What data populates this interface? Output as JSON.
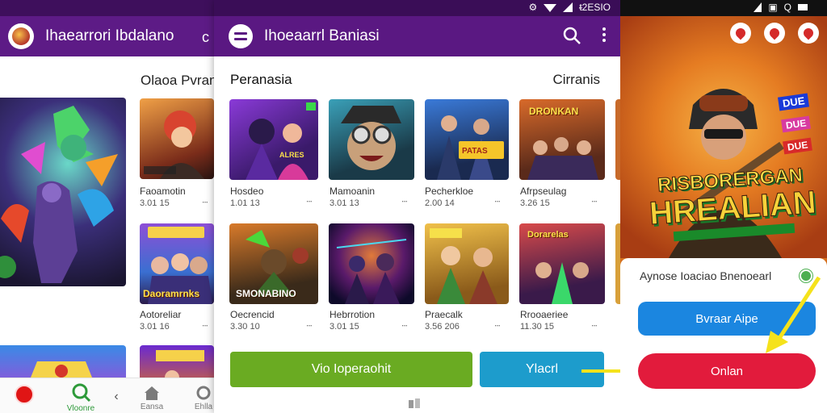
{
  "left_panel": {
    "app_title": "Ihaearrori Ibdalano",
    "back_glyph": "c",
    "section_label": "Olaoa Pvrano",
    "tiles": [
      {
        "name": "Faoamotin",
        "meta": "3.01 15"
      },
      {
        "name": "Aotoreliar",
        "meta": "3.01 16"
      }
    ],
    "tile_banner": "Daoramrnks",
    "bottom_nav": [
      {
        "label": "",
        "icon": "record-dot-icon"
      },
      {
        "label": "Vloonre",
        "icon": "search-icon"
      },
      {
        "label": "",
        "icon": "back-chevron-icon"
      },
      {
        "label": "Eansa",
        "icon": "home-icon"
      },
      {
        "label": "Ehlla",
        "icon": "refresh-icon"
      }
    ]
  },
  "middle_panel": {
    "status_text": "ᵵ2ESIO",
    "app_title": "Ihoeaarrl Baniasi",
    "section_title": "Peranasia",
    "section_more": "Cirranis",
    "tiles": [
      {
        "name": "Hosdeo",
        "meta": "1.01 13",
        "banner": ""
      },
      {
        "name": "Mamoanin",
        "meta": "3.01 13",
        "banner": ""
      },
      {
        "name": "Pecherkloe",
        "meta": "2.00 14",
        "banner": ""
      },
      {
        "name": "Afrpseulag",
        "meta": "3.26 15",
        "banner": "DRONKAN"
      },
      {
        "name": "Oecrencid",
        "meta": "3.30 10",
        "banner": "SMONABINO"
      },
      {
        "name": "Hebrrotion",
        "meta": "3.01 15",
        "banner": ""
      },
      {
        "name": "Praecalk",
        "meta": "3.56 206",
        "banner": ""
      },
      {
        "name": "Rrooaeriee",
        "meta": "11.30 15",
        "banner": ""
      }
    ],
    "btn_green": "Vio Ioperaohit",
    "btn_blue": "Ylacrl"
  },
  "right_panel": {
    "hero_title_line1": "RISBORERGAN",
    "hero_title_line2": "HREALIAN",
    "hero_badges": [
      "DUE",
      "DUE",
      "DUE"
    ],
    "card_title": "Aynose Ioaciao Bnenoearl",
    "btn_blue": "Bvraar Aipe",
    "btn_red": "Onlan"
  },
  "colors": {
    "purple_bar": "#5a1882",
    "green_button": "#6aab22",
    "blue_button": "#1d9ccc",
    "red_button": "#e21b3c",
    "arrow_yellow": "#f5e21b"
  }
}
